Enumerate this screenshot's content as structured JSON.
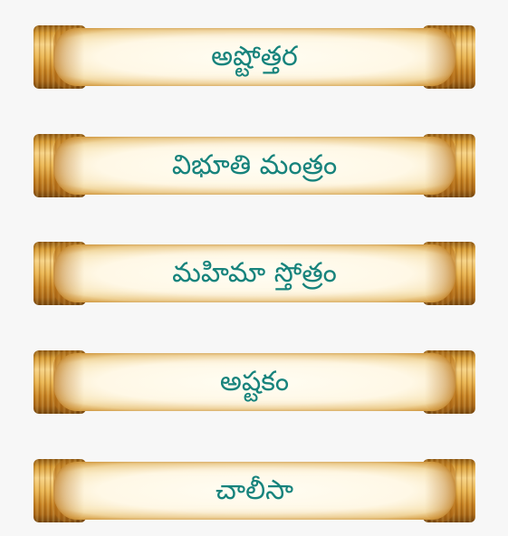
{
  "menu": {
    "items": [
      {
        "label": "అష్టోత్తర"
      },
      {
        "label": "విభూతి మంత్రం"
      },
      {
        "label": "మహిమా స్తోత్రం"
      },
      {
        "label": "అష్టకం"
      },
      {
        "label": "చాలీసా"
      }
    ]
  },
  "colors": {
    "label_text": "#17837c",
    "background": "#f7f7f7",
    "gold": "#d4962e",
    "parchment": "#fff8e6"
  }
}
